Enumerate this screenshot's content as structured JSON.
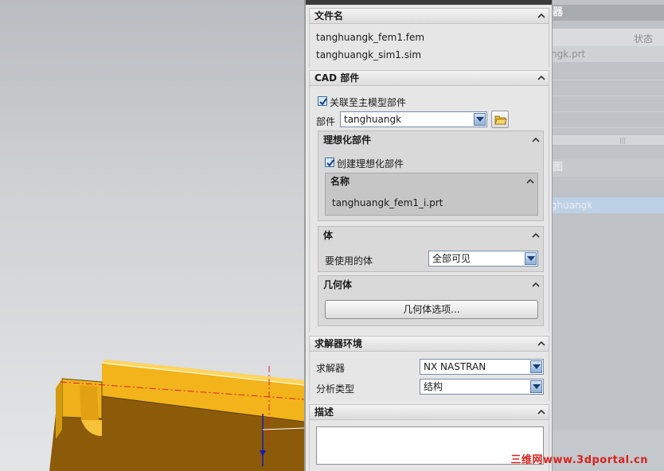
{
  "file_section": {
    "title": "文件名",
    "files": [
      "tanghuangk_fem1.fem",
      "tanghuangk_sim1.sim"
    ]
  },
  "cad_section": {
    "title": "CAD 部件",
    "link_master_label": "关联至主模型部件",
    "link_master_checked": true,
    "part_label": "部件",
    "part_value": "tanghuangk",
    "idealized": {
      "title": "理想化部件",
      "create_label": "创建理想化部件",
      "create_checked": true,
      "name_title": "名称",
      "name_value": "tanghuangk_fem1_i.prt"
    },
    "body": {
      "title": "体",
      "use_label": "要使用的体",
      "use_value": "全部可见"
    },
    "geometry": {
      "title": "几何体",
      "options_button": "几何体选项..."
    }
  },
  "solver_section": {
    "title": "求解器环境",
    "solver_label": "求解器",
    "solver_value": "NX NASTRAN",
    "analysis_label": "分析类型",
    "analysis_value": "结构"
  },
  "description_section": {
    "title": "描述",
    "value": ""
  },
  "background_window": {
    "header_fragment": "器",
    "status_column": "状态",
    "row_fragment": "ngk.prt",
    "header2_fragment": "图",
    "selected_row_fragment": "ghuangk"
  },
  "watermark": "三维网www.3dportal.cn",
  "colors": {
    "model_top": "#f3b51c",
    "model_side": "#8a5a0a",
    "centerline": "#d9232d",
    "watermark": "#d8221f"
  }
}
